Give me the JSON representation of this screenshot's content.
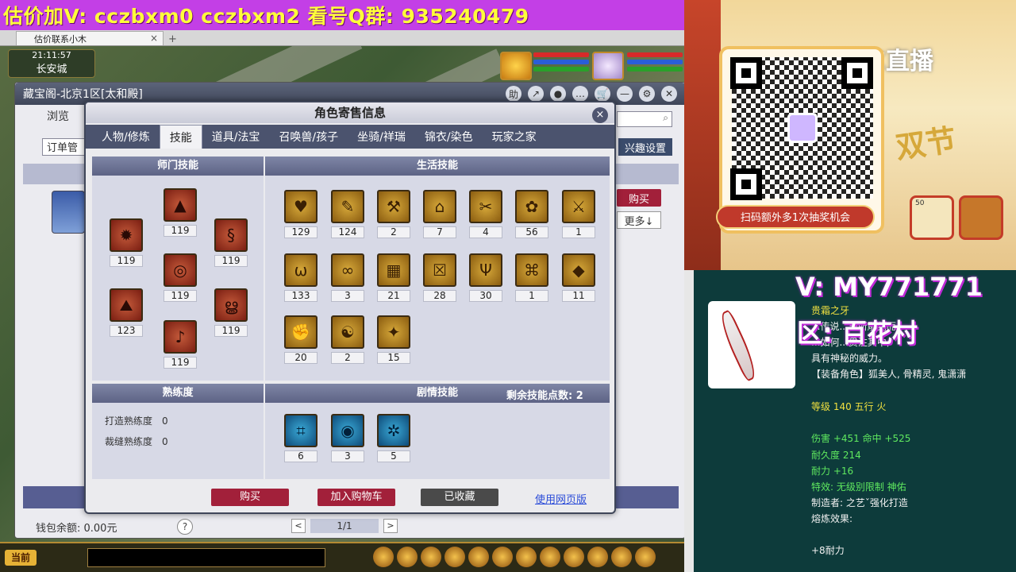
{
  "banner": {
    "text": "估价加V:  cczbxm0   cczbxm2   看号Q群: 935240479"
  },
  "browser": {
    "tab_label": "估价联系小木",
    "close": "×",
    "add": "+"
  },
  "hud": {
    "time": "21:11:57",
    "city": "长安城"
  },
  "zbg": {
    "title": "藏宝阁-北京1区[太和殿]",
    "controls": [
      "助",
      "↗",
      "●",
      "…",
      "🛒",
      "—",
      "⚙",
      "✕"
    ],
    "nav_label": "浏览",
    "order_label": "订单管",
    "interest_label": "兴趣设置",
    "buy_label": "购买",
    "more_label": "更多↓",
    "wallet_label": "钱包余额: 0.00元",
    "help": "?",
    "page": "1/1",
    "prev": "<",
    "next": ">"
  },
  "modal": {
    "title": "角色寄售信息",
    "close": "×",
    "tabs": [
      "人物/修炼",
      "技能",
      "道具/法宝",
      "召唤兽/孩子",
      "坐骑/祥瑞",
      "锦衣/染色",
      "玩家之家"
    ],
    "active_tab": "技能",
    "school_header": "师门技能",
    "life_header": "生活技能",
    "proficiency_header": "熟练度",
    "story_header": "剧情技能",
    "remaining_label": "剩余技能点数: 2",
    "school_skills": [
      "119",
      "119",
      "119",
      "119",
      "119",
      "123",
      "119",
      "119"
    ],
    "life_skills": [
      "129",
      "124",
      "2",
      "7",
      "4",
      "56",
      "1",
      "133",
      "3",
      "21",
      "28",
      "30",
      "1",
      "11",
      "20",
      "2",
      "15"
    ],
    "story_skills": [
      "6",
      "3",
      "5"
    ],
    "proficiency": {
      "forge_label": "打造熟练度",
      "forge_value": "0",
      "tailor_label": "裁缝熟练度",
      "tailor_value": "0"
    },
    "buttons": {
      "buy": "购买",
      "cart": "加入购物车",
      "favorited": "已收藏",
      "web": "使用网页版"
    }
  },
  "gamebar": {
    "now_label": "当前"
  },
  "right": {
    "qr_caption": "扫码额外多1次抽奖机会",
    "cc_logo": "CC直播",
    "promo": "双节",
    "card_value": "50",
    "contact_v": "V: MY771771",
    "contact_zone": "区: 百花村",
    "item": {
      "name": "贵霜之牙",
      "desc1": "...传说...牙所雕刻而",
      "desc2": "...如何...贯注其中,",
      "desc3": "具有神秘的威力。",
      "role": "【装备角色】狐美人, 骨精灵, 鬼潇潇",
      "level": "等级 140 五行 火",
      "dmg": "伤害 +451 命中 +525",
      "durability": "耐久度 214",
      "endurance": "耐力 +16",
      "effect": "特效: 无级别限制 神佑",
      "maker": "制造者: 之艺ˇ强化打造",
      "smelt": "熔炼效果:",
      "smelt_val": "+8耐力"
    }
  },
  "colors": {
    "banner_bg": "#c33fe6",
    "banner_text": "#ffff3a",
    "buy_red": "#a2203a",
    "link_blue": "#2a4bd8"
  }
}
